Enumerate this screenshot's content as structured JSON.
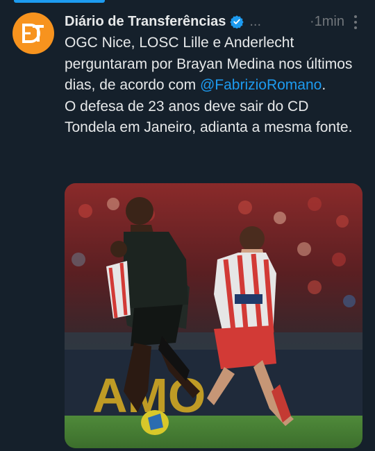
{
  "tweet": {
    "author_name": "Diário de Transferências",
    "truncation": "...",
    "time_separator": "·",
    "time": "1min",
    "line1": "OGC Nice, LOSC Lille e Anderlecht perguntaram por Brayan Medina nos últimos dias, de acordo com",
    "mention": "@FabrizioRomano",
    "mention_suffix": ".",
    "line2": "O defesa de 23 anos deve sair do CD Tondela em Janeiro, adianta a mesma fonte."
  },
  "colors": {
    "background": "#15202b",
    "accent": "#1d9bf0",
    "avatar": "#f7931e",
    "muted": "#71767b"
  },
  "icons": [
    "avatar-logo-icon",
    "verified-badge-icon",
    "more-options-icon"
  ]
}
